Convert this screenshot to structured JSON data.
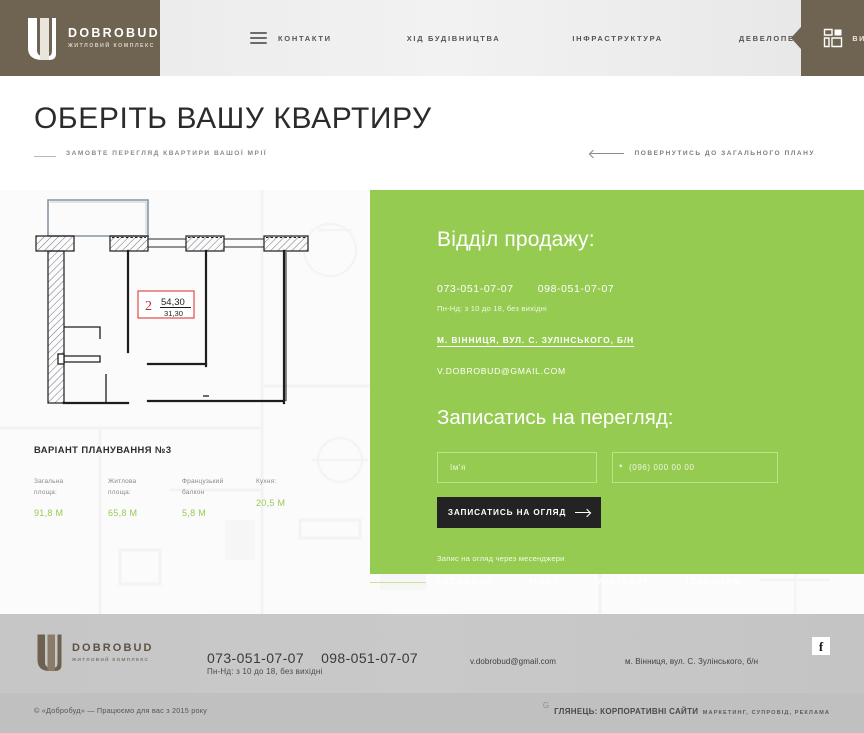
{
  "header": {
    "brand": {
      "name": "DOBROBUD",
      "tagline": "ЖИТЛОВИЙ КОМПЛЕКС"
    },
    "nav": [
      {
        "label": "КОНТАКТИ"
      },
      {
        "label": "ХІД БУДІВНИЦТВА"
      },
      {
        "label": "ІНФРАСТРУКТУРА"
      },
      {
        "label": "ДЕВЕЛОПЕР"
      }
    ],
    "cta": {
      "label": "ВИБІР КВАРТИРИ",
      "icon": "floorplan-icon"
    },
    "brand_color": "#6f6451"
  },
  "title": {
    "heading": "ОБЕРІТЬ ВАШУ КВАРТИРУ",
    "subtitle": "ЗАМОВТЕ ПЕРЕГЛЯД КВАРТИРИ ВАШОЇ МРІЇ",
    "back_link": "ПОВЕРНУТИСЬ ДО ЗАГАЛЬНОГО ПЛАНУ"
  },
  "floorplan": {
    "badge_rooms": "2",
    "badge_total_area": "54,30",
    "badge_living_area": "31,30"
  },
  "apartment": {
    "variant": "ВАРІАНТ ПЛАНУВАННЯ №3",
    "stats": [
      {
        "label": "Загальна\nплоща:",
        "label_l1": "Загальна",
        "label_l2": "площа:",
        "value": "91,8 М"
      },
      {
        "label": "Житлова\nплоща:",
        "label_l1": "Житлова",
        "label_l2": "площа:",
        "value": "65,8 М"
      },
      {
        "label": "Французький\nбалкон",
        "label_l1": "Французький",
        "label_l2": "балкон",
        "value": "5,8 М"
      },
      {
        "label": "Кухня:",
        "label_l1": "Кухня:",
        "label_l2": "",
        "value": "20,5 М"
      }
    ],
    "value_color": "#96cb52"
  },
  "sales": {
    "title": "Відділ продажу:",
    "phone1": "073-051-07-07",
    "phone2": "098-051-07-07",
    "hours": "Пн-Нд: з 10 до 18,  без вихідні",
    "address": "М. ВІННИЦЯ, ВУЛ. С. ЗУЛІНСЬКОГО, Б/Н",
    "email": "V.DOBROBUD@GMAIL.COM",
    "panel_color": "#96cb52"
  },
  "form": {
    "title": "Записатись на перегляд:",
    "name_placeholder": "Ім'я",
    "name_value": "",
    "phone_placeholder": "(096) 000 00 00",
    "phone_value": "",
    "required_mark": "*",
    "submit_label": "ЗАПИСАТИСЬ НА ОГЛЯД",
    "messenger_note": "Запис на огляд через месенджери",
    "messengers": [
      {
        "label": "FACEBOOK"
      },
      {
        "label": "VIBER"
      },
      {
        "label": "WHATSAPP"
      },
      {
        "label": "TELEGRAM"
      }
    ]
  },
  "footer": {
    "brand": {
      "name": "DOBROBUD",
      "tagline": "ЖИТЛОВИЙ КОМПЛЕКС"
    },
    "phone1": "073-051-07-07",
    "phone2": "098-051-07-07",
    "hours": "Пн-Нд: з 10 до 18,  без вихідні",
    "email": "v.dobrobud@gmail.com",
    "address": "м. Вінниця, вул. С. Зулінського, б/н",
    "facebook_glyph": "f"
  },
  "copyright": {
    "text": "© «Добробуд» — Працюємо для вас з 2015 року",
    "credit_mark": "G",
    "credit_line1": "ГЛЯНЕЦЬ: КОРПОРАТИВНІ САЙТИ",
    "credit_line2": "МАРКЕТИНГ, СУПРОВІД, РЕКЛАМА"
  }
}
